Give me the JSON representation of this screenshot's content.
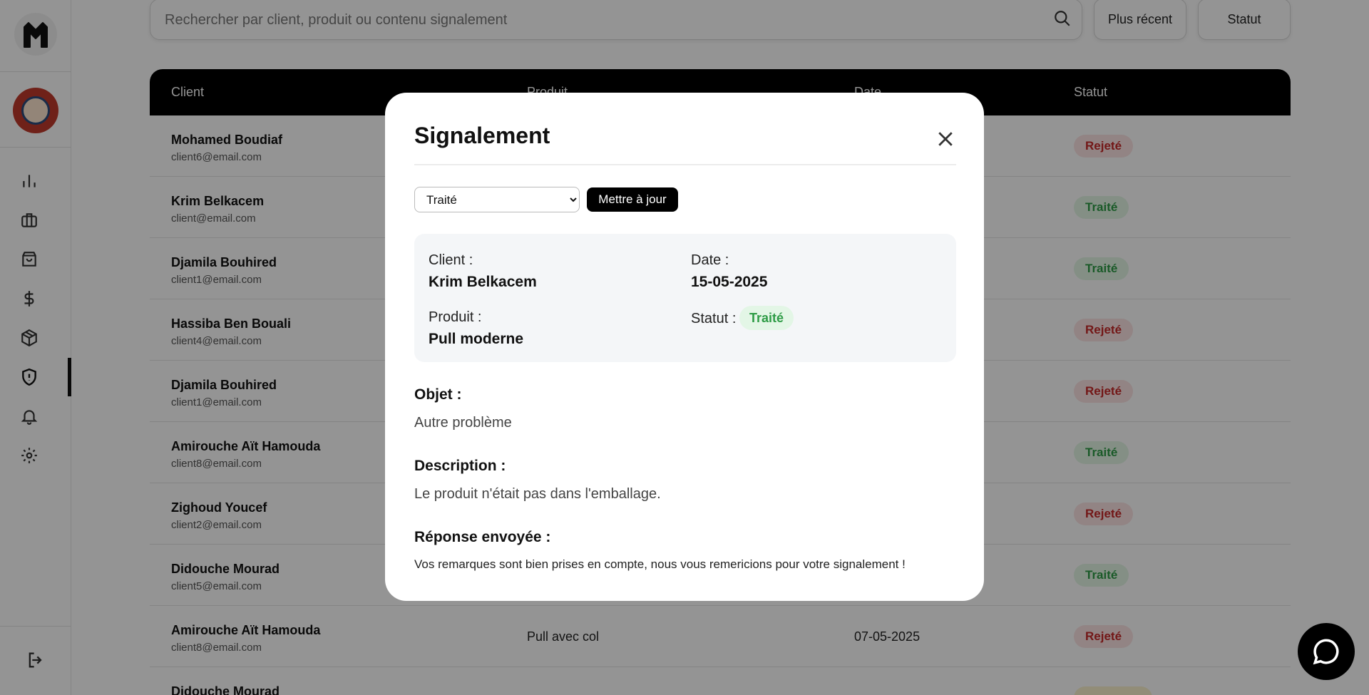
{
  "search": {
    "placeholder": "Rechercher par client, produit ou contenu signalement"
  },
  "filters": {
    "sort_label": "Plus récent",
    "status_label": "Statut"
  },
  "table": {
    "headers": {
      "client": "Client",
      "product": "Produit",
      "date": "Date",
      "status": "Statut"
    },
    "rows": [
      {
        "name": "Mohamed Boudiaf",
        "email": "client6@email.com",
        "product": "",
        "date": "",
        "status": "Rejeté",
        "status_kind": "rejected"
      },
      {
        "name": "Krim Belkacem",
        "email": "client@email.com",
        "product": "",
        "date": "",
        "status": "Traité",
        "status_kind": "processed"
      },
      {
        "name": "Djamila Bouhired",
        "email": "client1@email.com",
        "product": "",
        "date": "",
        "status": "Traité",
        "status_kind": "processed"
      },
      {
        "name": "Hassiba Ben Bouali",
        "email": "client4@email.com",
        "product": "",
        "date": "",
        "status": "Rejeté",
        "status_kind": "rejected"
      },
      {
        "name": "Djamila Bouhired",
        "email": "client1@email.com",
        "product": "",
        "date": "",
        "status": "Rejeté",
        "status_kind": "rejected"
      },
      {
        "name": "Amirouche Aït Hamouda",
        "email": "client8@email.com",
        "product": "",
        "date": "",
        "status": "Traité",
        "status_kind": "processed"
      },
      {
        "name": "Zighoud Youcef",
        "email": "client2@email.com",
        "product": "",
        "date": "",
        "status": "Rejeté",
        "status_kind": "rejected"
      },
      {
        "name": "Didouche Mourad",
        "email": "client5@email.com",
        "product": "",
        "date": "",
        "status": "Traité",
        "status_kind": "processed"
      },
      {
        "name": "Amirouche Aït Hamouda",
        "email": "client8@email.com",
        "product": "Pull avec col",
        "date": "07-05-2025",
        "status": "Rejeté",
        "status_kind": "rejected"
      },
      {
        "name": "Didouche Mourad",
        "email": "",
        "product": "",
        "date": "",
        "status": "",
        "status_kind": "pending"
      }
    ]
  },
  "modal": {
    "title": "Signalement",
    "status_options": [
      "Traité"
    ],
    "selected_status": "Traité",
    "update_label": "Mettre à jour",
    "client_label": "Client :",
    "client_value": "Krim Belkacem",
    "date_label": "Date :",
    "date_value": "15-05-2025",
    "product_label": "Produit :",
    "product_value": "Pull moderne",
    "status_label": "Statut :",
    "status_value": "Traité",
    "object_label": "Objet :",
    "object_value": "Autre problème",
    "description_label": "Description :",
    "description_value": "Le produit n'était pas dans l'emballage.",
    "response_label": "Réponse envoyée :",
    "response_value": "Vos remarques sont bien prises en compte, nous vous remericions pour votre signalement !"
  },
  "colors": {
    "rejected": "#c62828",
    "processed": "#2e9c46",
    "pending": "#b58a00"
  }
}
